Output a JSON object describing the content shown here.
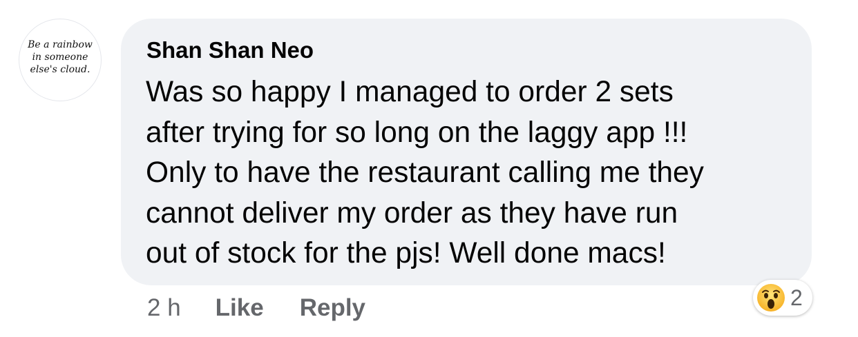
{
  "comment": {
    "author": "Shan Shan Neo",
    "text": "Was so happy I managed to order 2 sets\nafter trying for so long on the laggy app !!!\nOnly to have the restaurant calling me they\ncannot deliver my order as they have run\nout of stock for the pjs! Well done macs!",
    "avatar_text": [
      "Be a rainbow",
      "in someone",
      "else's cloud."
    ]
  },
  "actions": {
    "timestamp": "2 h",
    "like_label": "Like",
    "reply_label": "Reply"
  },
  "reaction": {
    "icon": "wow-emoji-icon",
    "count": "2"
  },
  "colors": {
    "bubble_bg": "#f0f2f5",
    "text": "#050505",
    "secondary_text": "#65676b"
  }
}
